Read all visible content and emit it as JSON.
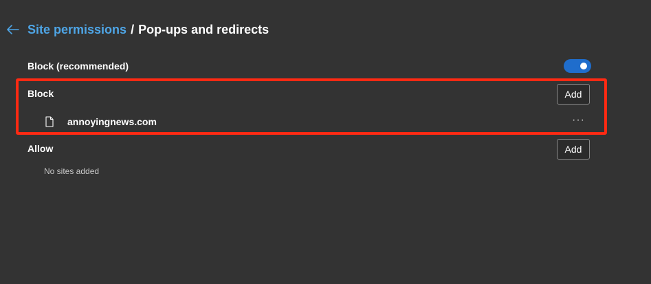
{
  "header": {
    "back_icon": "arrow-left-icon",
    "breadcrumb_link": "Site permissions",
    "separator": "/",
    "current": "Pop-ups and redirects"
  },
  "block_recommended": {
    "label": "Block (recommended)",
    "toggle_on": true,
    "toggle_color": "#1f6dcc"
  },
  "block": {
    "label": "Block",
    "add_label": "Add",
    "sites": [
      {
        "domain": "annoyingnews.com",
        "icon": "file-icon",
        "more": "···"
      }
    ]
  },
  "allow": {
    "label": "Allow",
    "add_label": "Add",
    "empty_text": "No sites added"
  },
  "accent_colors": {
    "link": "#4ea5e6",
    "highlight": "#ff2a13",
    "background": "#333333"
  }
}
